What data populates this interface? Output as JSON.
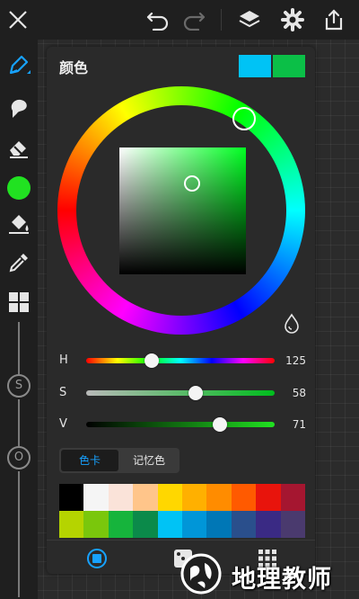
{
  "colors": {
    "accent": "#17a2ff",
    "current_color": "#00c3f5",
    "new_color": "#0bbf47",
    "brush_color": "#21e221"
  },
  "topbar": {
    "icons": [
      "close-icon",
      "undo-icon",
      "redo-icon",
      "layers-icon",
      "gear-icon",
      "share-icon"
    ]
  },
  "sidebar": {
    "tools": [
      "brush-icon",
      "smudge-icon",
      "eraser-icon",
      "color-swatch",
      "fill-bucket-icon",
      "eyedropper-icon",
      "grid-icon"
    ],
    "size_knob_label": "S",
    "opacity_knob_label": "O"
  },
  "panel": {
    "title": "颜色",
    "sliders": [
      {
        "label": "H",
        "value": "125",
        "fraction": 0.347
      },
      {
        "label": "S",
        "value": "58",
        "fraction": 0.58
      },
      {
        "label": "V",
        "value": "71",
        "fraction": 0.71
      }
    ],
    "tabs": {
      "active": "色卡",
      "inactive": "记忆色"
    },
    "palette": [
      "#000000",
      "#f5f5f5",
      "#fae3d9",
      "#ffc58a",
      "#ffd700",
      "#ffb000",
      "#ff8c00",
      "#ff5a00",
      "#e8140c",
      "#a51630",
      "#b5d400",
      "#7ac70c",
      "#16b43c",
      "#0b8a4a",
      "#00c3f5",
      "#0096d8",
      "#0077b6",
      "#2a4f8c",
      "#3a2a84",
      "#4a3a6e"
    ],
    "bottom_icons": [
      "color-wheel-mode-icon",
      "dice-icon",
      "palette-grid-icon"
    ]
  },
  "watermark": {
    "text": "地理教师"
  }
}
